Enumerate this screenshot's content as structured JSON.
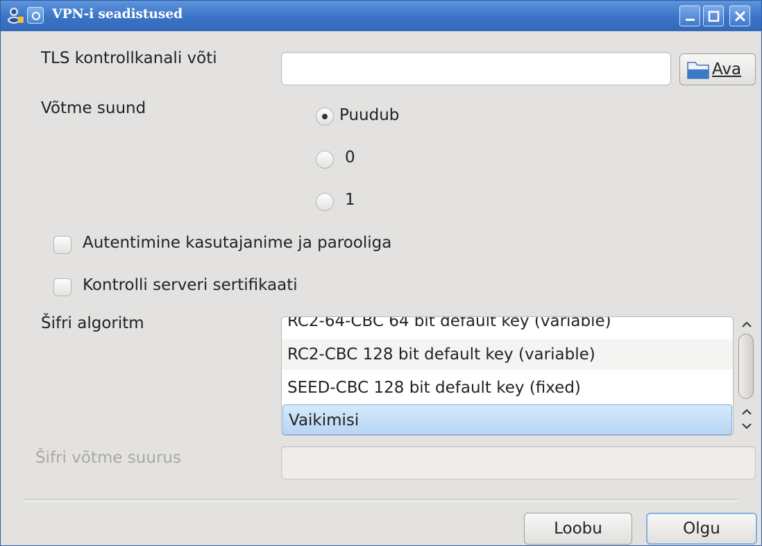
{
  "window": {
    "title": "VPN-i seadistused",
    "minimize_icon": "minimize-icon",
    "maximize_icon": "maximize-icon",
    "close_icon": "close-icon",
    "accent": "#3a73c6"
  },
  "tls_key": {
    "label": "TLS kontrollkanali võti",
    "value": "",
    "open_button": "Ava",
    "open_icon": "open-file-icon"
  },
  "key_direction": {
    "label": "Võtme suund",
    "options": [
      {
        "label": "Puudub",
        "selected": true
      },
      {
        "label": "0",
        "selected": false
      },
      {
        "label": "1",
        "selected": false
      }
    ]
  },
  "checkboxes": [
    {
      "label": "Autentimine kasutajanime ja parooliga",
      "checked": false
    },
    {
      "label": "Kontrolli serveri sertifikaati",
      "checked": false
    }
  ],
  "cipher": {
    "label": "Šifri algoritm",
    "items": [
      "RC2-64-CBC 64 bit default key (variable)",
      "RC2-CBC 128 bit default key (variable)",
      "SEED-CBC 128 bit default key (fixed)",
      "Vaikimisi"
    ],
    "selected": "Vaikimisi"
  },
  "cipher_key_size": {
    "label": "Šifri võtme suurus",
    "value": ""
  },
  "buttons": {
    "cancel": "Loobu",
    "ok": "Olgu"
  }
}
